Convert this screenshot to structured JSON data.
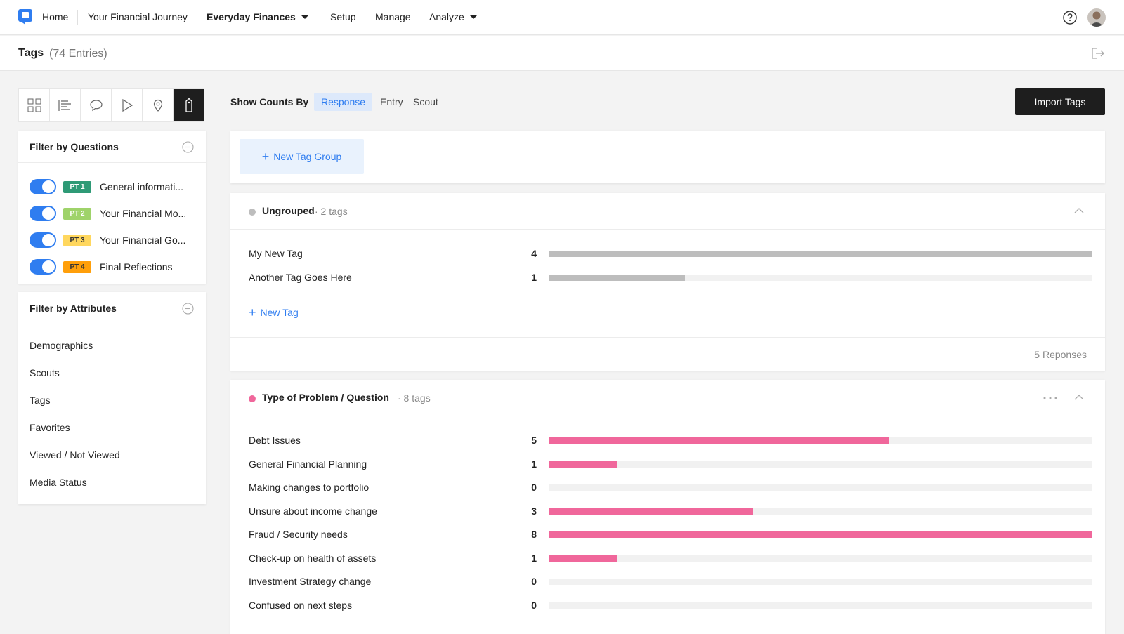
{
  "nav": {
    "home": "Home",
    "journey": "Your Financial Journey",
    "project": "Everyday Finances",
    "setup": "Setup",
    "manage": "Manage",
    "analyze": "Analyze"
  },
  "title": {
    "label": "Tags",
    "count": "(74 Entries)"
  },
  "view_buttons": [
    "grid-icon",
    "list-icon",
    "comment-icon",
    "play-icon",
    "location-pin-icon",
    "tag-icon"
  ],
  "filter_questions": {
    "title": "Filter by Questions",
    "items": [
      {
        "badge": "PT 1",
        "label": "General informati...",
        "badge_bg": "#2e9a76",
        "badge_fg": "#ffffff",
        "enabled": true
      },
      {
        "badge": "PT 2",
        "label": "Your Financial Mo...",
        "badge_bg": "#9fd36a",
        "badge_fg": "#ffffff",
        "enabled": true
      },
      {
        "badge": "PT 3",
        "label": "Your Financial Go...",
        "badge_bg": "#ffd75e",
        "badge_fg": "#333333",
        "enabled": true
      },
      {
        "badge": "PT 4",
        "label": "Final Reflections",
        "badge_bg": "#ff9f0a",
        "badge_fg": "#333333",
        "enabled": true
      }
    ]
  },
  "filter_attributes": {
    "title": "Filter by Attributes",
    "items": [
      "Demographics",
      "Scouts",
      "Tags",
      "Favorites",
      "Viewed / Not Viewed",
      "Media Status"
    ]
  },
  "counts_by": {
    "label": "Show Counts By",
    "options": [
      "Response",
      "Entry",
      "Scout"
    ],
    "selected": "Response"
  },
  "import_button": "Import Tags",
  "new_tag_group": "New Tag Group",
  "groups": [
    {
      "name": "Ungrouped",
      "meta": "· 2 tags",
      "color": "#bdbdbd",
      "bar_color": "#bdbdbd",
      "max": 4,
      "tags": [
        {
          "name": "My New Tag",
          "count": 4
        },
        {
          "name": "Another Tag Goes Here",
          "count": 1
        }
      ],
      "new_tag": "New Tag",
      "responses": "5  Reponses"
    },
    {
      "name": "Type of Problem / Question",
      "meta": "· 8 tags",
      "color": "#f0679b",
      "bar_color": "#f0679b",
      "max": 8,
      "tags": [
        {
          "name": "Debt Issues",
          "count": 5
        },
        {
          "name": "General Financial Planning",
          "count": 1
        },
        {
          "name": "Making changes to portfolio",
          "count": 0
        },
        {
          "name": "Unsure about income change",
          "count": 3
        },
        {
          "name": "Fraud / Security needs",
          "count": 8
        },
        {
          "name": "Check-up on health of assets",
          "count": 1
        },
        {
          "name": "Investment Strategy change",
          "count": 0
        },
        {
          "name": "Confused on next steps",
          "count": 0
        }
      ]
    }
  ]
}
